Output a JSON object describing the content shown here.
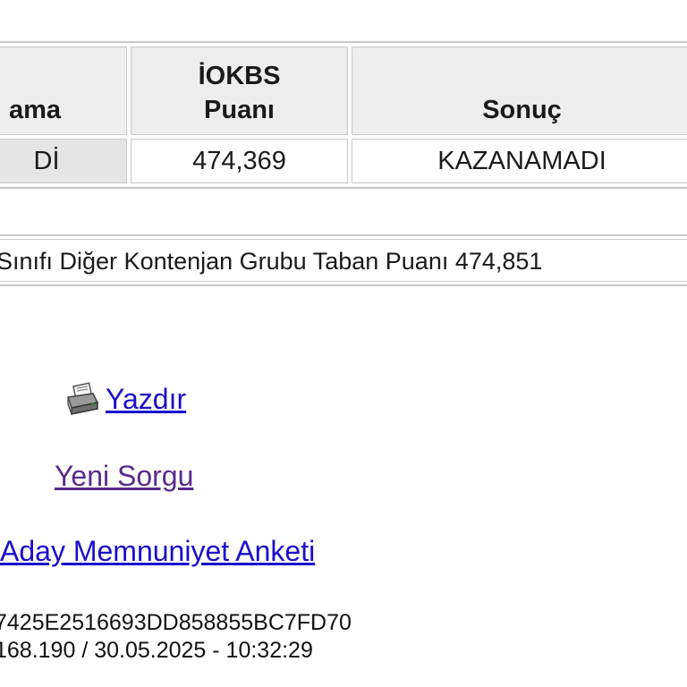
{
  "table": {
    "headers": {
      "col1": "ama",
      "col2_line1": "İOKBS",
      "col2_line2": "Puanı",
      "col3": "Sonuç"
    },
    "row": {
      "col1": "Dİ",
      "col2": "474,369",
      "col3": "KAZANAMADI"
    }
  },
  "info": {
    "text": "Sınıfı Diğer Kontenjan Grubu Taban Puanı 474,851"
  },
  "links": {
    "print": "Yazdır",
    "new_query": "Yeni Sorgu",
    "survey": "Aday Memnuniyet Anketi"
  },
  "footer": {
    "hash": "7425E2516693DD858855BC7FD70",
    "ip_time": "168.190 / 30.05.2025 - 10:32:29"
  },
  "colors": {
    "link": "#1a0dcc",
    "visited_link": "#5a2a8e",
    "header_bg": "#ededed",
    "border": "#c8c8c8"
  },
  "icons": {
    "print": "printer-icon"
  }
}
